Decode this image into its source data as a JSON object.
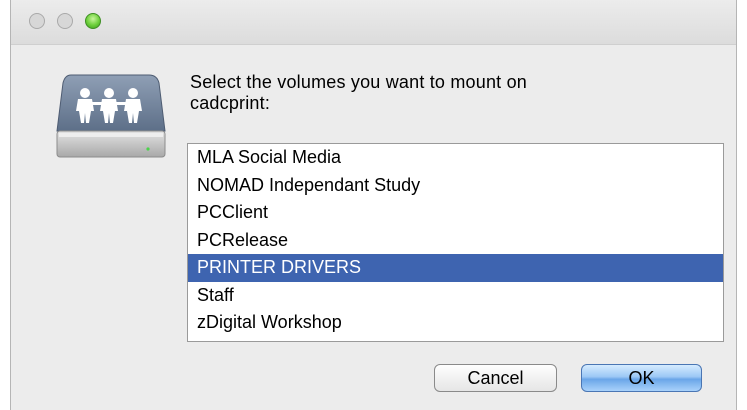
{
  "dialog": {
    "prompt_line1": "Select the volumes you want to mount on",
    "prompt_line2": "cadcprint:",
    "icon": "network-share-icon"
  },
  "volumes": [
    {
      "label": "MLA Social Media",
      "selected": false
    },
    {
      "label": "NOMAD Independant Study",
      "selected": false
    },
    {
      "label": "PCClient",
      "selected": false
    },
    {
      "label": "PCRelease",
      "selected": false
    },
    {
      "label": "PRINTER DRIVERS",
      "selected": true
    },
    {
      "label": "Staff",
      "selected": false
    },
    {
      "label": "zDigital Workshop",
      "selected": false
    }
  ],
  "buttons": {
    "cancel_label": "Cancel",
    "ok_label": "OK"
  },
  "colors": {
    "selection": "#3e64b0",
    "window_background": "#ececec",
    "default_button": "#6aa6e8"
  }
}
